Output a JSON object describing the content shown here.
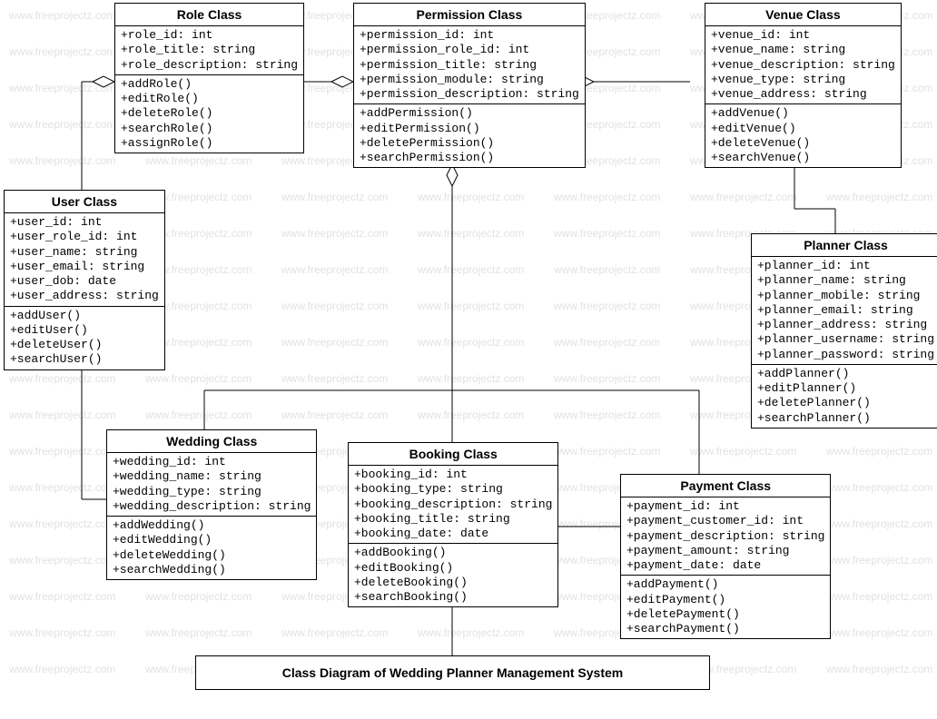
{
  "caption": "Class Diagram of Wedding Planner Management System",
  "watermark": "www.freeprojectz.com",
  "classes": {
    "role": {
      "title": "Role Class",
      "attrs": [
        "+role_id: int",
        "+role_title: string",
        "+role_description: string"
      ],
      "ops": [
        "+addRole()",
        "+editRole()",
        "+deleteRole()",
        "+searchRole()",
        "+assignRole()"
      ]
    },
    "permission": {
      "title": "Permission Class",
      "attrs": [
        "+permission_id: int",
        "+permission_role_id: int",
        "+permission_title: string",
        "+permission_module: string",
        "+permission_description: string"
      ],
      "ops": [
        "+addPermission()",
        "+editPermission()",
        "+deletePermission()",
        "+searchPermission()"
      ]
    },
    "venue": {
      "title": "Venue Class",
      "attrs": [
        "+venue_id: int",
        "+venue_name: string",
        "+venue_description: string",
        "+venue_type: string",
        "+venue_address: string"
      ],
      "ops": [
        "+addVenue()",
        "+editVenue()",
        "+deleteVenue()",
        "+searchVenue()"
      ]
    },
    "user": {
      "title": "User Class",
      "attrs": [
        "+user_id: int",
        "+user_role_id: int",
        "+user_name: string",
        "+user_email: string",
        "+user_dob: date",
        "+user_address: string"
      ],
      "ops": [
        "+addUser()",
        "+editUser()",
        "+deleteUser()",
        "+searchUser()"
      ]
    },
    "planner": {
      "title": "Planner Class",
      "attrs": [
        "+planner_id: int",
        "+planner_name: string",
        "+planner_mobile: string",
        "+planner_email: string",
        "+planner_address: string",
        "+planner_username: string",
        "+planner_password: string"
      ],
      "ops": [
        "+addPlanner()",
        "+editPlanner()",
        "+deletePlanner()",
        "+searchPlanner()"
      ]
    },
    "wedding": {
      "title": "Wedding Class",
      "attrs": [
        "+wedding_id: int",
        "+wedding_name: string",
        "+wedding_type: string",
        "+wedding_description: string"
      ],
      "ops": [
        "+addWedding()",
        "+editWedding()",
        "+deleteWedding()",
        "+searchWedding()"
      ]
    },
    "booking": {
      "title": "Booking Class",
      "attrs": [
        "+booking_id: int",
        "+booking_type: string",
        "+booking_description: string",
        "+booking_title: string",
        "+booking_date: date"
      ],
      "ops": [
        "+addBooking()",
        "+editBooking()",
        "+deleteBooking()",
        "+searchBooking()"
      ]
    },
    "payment": {
      "title": "Payment Class",
      "attrs": [
        "+payment_id: int",
        "+payment_customer_id: int",
        "+payment_description: string",
        "+payment_amount: string",
        "+payment_date: date"
      ],
      "ops": [
        "+addPayment()",
        "+editPayment()",
        "+deletePayment()",
        "+searchPayment()"
      ]
    }
  }
}
